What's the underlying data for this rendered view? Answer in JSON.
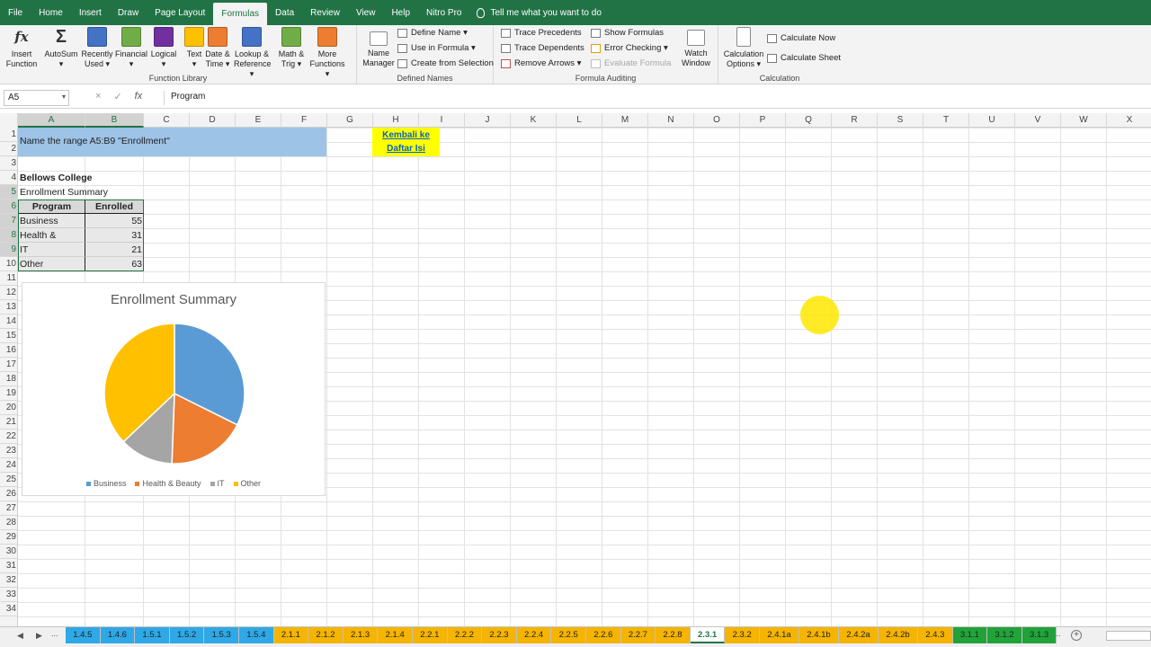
{
  "menu": {
    "tabs": [
      "File",
      "Home",
      "Insert",
      "Draw",
      "Page Layout",
      "Formulas",
      "Data",
      "Review",
      "View",
      "Help",
      "Nitro Pro"
    ],
    "active": "Formulas",
    "tell_me": "Tell me what you want to do"
  },
  "ribbon": {
    "function_library": {
      "label": "Function Library",
      "buttons": [
        {
          "line1": "Insert",
          "line2": "Function",
          "icon": "fx-icon",
          "color": "#ffffff"
        },
        {
          "line1": "AutoSum",
          "line2": "▾",
          "icon": "sigma-icon",
          "color": "#ffffff"
        },
        {
          "line1": "Recently",
          "line2": "Used ▾",
          "icon": "star-book-icon",
          "color": "#4472c4"
        },
        {
          "line1": "Financial",
          "line2": "▾",
          "icon": "book-icon",
          "color": "#70ad47"
        },
        {
          "line1": "Logical",
          "line2": "▾",
          "icon": "question-book-icon",
          "color": "#7030a0"
        },
        {
          "line1": "Text",
          "line2": "▾",
          "icon": "a-book-icon",
          "color": "#ffc000"
        },
        {
          "line1": "Date &",
          "line2": "Time ▾",
          "icon": "calendar-book-icon",
          "color": "#ed7d31"
        },
        {
          "line1": "Lookup &",
          "line2": "Reference ▾",
          "icon": "magnifier-book-icon",
          "color": "#4472c4"
        },
        {
          "line1": "Math &",
          "line2": "Trig ▾",
          "icon": "theta-book-icon",
          "color": "#70ad47"
        },
        {
          "line1": "More",
          "line2": "Functions ▾",
          "icon": "more-book-icon",
          "color": "#ed7d31"
        }
      ]
    },
    "defined_names": {
      "label": "Defined Names",
      "name_manager": {
        "line1": "Name",
        "line2": "Manager"
      },
      "items": [
        "Define Name ▾",
        "Use in Formula ▾",
        "Create from Selection"
      ]
    },
    "formula_auditing": {
      "label": "Formula Auditing",
      "left": [
        "Trace Precedents",
        "Trace Dependents",
        "Remove Arrows ▾"
      ],
      "right": [
        "Show Formulas",
        "Error Checking ▾",
        "Evaluate Formula"
      ],
      "watch": {
        "line1": "Watch",
        "line2": "Window"
      }
    },
    "calculation": {
      "label": "Calculation",
      "options": {
        "line1": "Calculation",
        "line2": "Options ▾"
      },
      "items": [
        "Calculate Now",
        "Calculate Sheet"
      ]
    }
  },
  "formula_bar": {
    "name_box": "A5",
    "value": "Program",
    "cancel": "×",
    "enter": "✓",
    "fx": "fx"
  },
  "grid": {
    "columns": [
      "A",
      "B",
      "C",
      "D",
      "E",
      "F",
      "G",
      "H",
      "I",
      "J",
      "K",
      "L",
      "M",
      "N",
      "O",
      "P",
      "Q",
      "R",
      "S",
      "T",
      "U",
      "V",
      "W",
      "X"
    ],
    "selected_columns": [
      "A",
      "B"
    ],
    "rows": [
      "1",
      "2",
      "3",
      "4",
      "5",
      "6",
      "7",
      "8",
      "9",
      "10",
      "11",
      "12",
      "13",
      "14",
      "15",
      "16",
      "17",
      "18",
      "19",
      "20",
      "21",
      "22",
      "23",
      "24",
      "25",
      "26",
      "27",
      "28",
      "29",
      "30",
      "31",
      "32",
      "33",
      "34"
    ],
    "selected_rows": [
      "5",
      "6",
      "7",
      "8",
      "9"
    ]
  },
  "sheet": {
    "instruction": "Name the range A5:B9 \"Enrollment\"",
    "link_line1": "Kembali ke",
    "link_line2": "Daftar Isi",
    "college": "Bellows College",
    "subtitle": "Enrollment Summary",
    "table": {
      "headers": [
        "Program",
        "Enrolled"
      ],
      "rows": [
        {
          "program": "Business",
          "enrolled": "55"
        },
        {
          "program": "Health & Beauty",
          "enrolled": "31"
        },
        {
          "program": "IT",
          "enrolled": "21"
        },
        {
          "program": "Other",
          "enrolled": "63"
        }
      ]
    }
  },
  "chart_data": {
    "type": "pie",
    "title": "Enrollment Summary",
    "categories": [
      "Business",
      "Health & Beauty",
      "IT",
      "Other"
    ],
    "values": [
      55,
      31,
      21,
      63
    ],
    "colors": [
      "#5b9bd5",
      "#ed7d31",
      "#a5a5a5",
      "#ffc000"
    ],
    "legend": "bottom"
  },
  "tabs": {
    "nav_prev": "◀",
    "nav_next": "▶",
    "ellipsis": "...",
    "more": "...",
    "add": "+",
    "active": "2.3.1",
    "items": [
      {
        "name": "1.4.5",
        "color": "#2ea8e6"
      },
      {
        "name": "1.4.6",
        "color": "#2ea8e6"
      },
      {
        "name": "1.5.1",
        "color": "#2ea8e6"
      },
      {
        "name": "1.5.2",
        "color": "#2ea8e6"
      },
      {
        "name": "1.5.3",
        "color": "#2ea8e6"
      },
      {
        "name": "1.5.4",
        "color": "#2ea8e6"
      },
      {
        "name": "2.1.1",
        "color": "#f5b400"
      },
      {
        "name": "2.1.2",
        "color": "#f5b400"
      },
      {
        "name": "2.1.3",
        "color": "#f5b400"
      },
      {
        "name": "2.1.4",
        "color": "#f5b400"
      },
      {
        "name": "2.2.1",
        "color": "#f5b400"
      },
      {
        "name": "2.2.2",
        "color": "#f5b400"
      },
      {
        "name": "2.2.3",
        "color": "#f5b400"
      },
      {
        "name": "2.2.4",
        "color": "#f5b400"
      },
      {
        "name": "2.2.5",
        "color": "#f5b400"
      },
      {
        "name": "2.2.6",
        "color": "#f5b400"
      },
      {
        "name": "2.2.7",
        "color": "#f5b400"
      },
      {
        "name": "2.2.8",
        "color": "#f5b400"
      },
      {
        "name": "2.3.1",
        "color": "#ffffff"
      },
      {
        "name": "2.3.2",
        "color": "#f5b400"
      },
      {
        "name": "2.4.1a",
        "color": "#f5b400"
      },
      {
        "name": "2.4.1b",
        "color": "#f5b400"
      },
      {
        "name": "2.4.2a",
        "color": "#f5b400"
      },
      {
        "name": "2.4.2b",
        "color": "#f5b400"
      },
      {
        "name": "2.4.3",
        "color": "#f5b400"
      },
      {
        "name": "3.1.1",
        "color": "#21a33a"
      },
      {
        "name": "3.1.2",
        "color": "#21a33a"
      },
      {
        "name": "3.1.3",
        "color": "#21a33a"
      }
    ]
  }
}
